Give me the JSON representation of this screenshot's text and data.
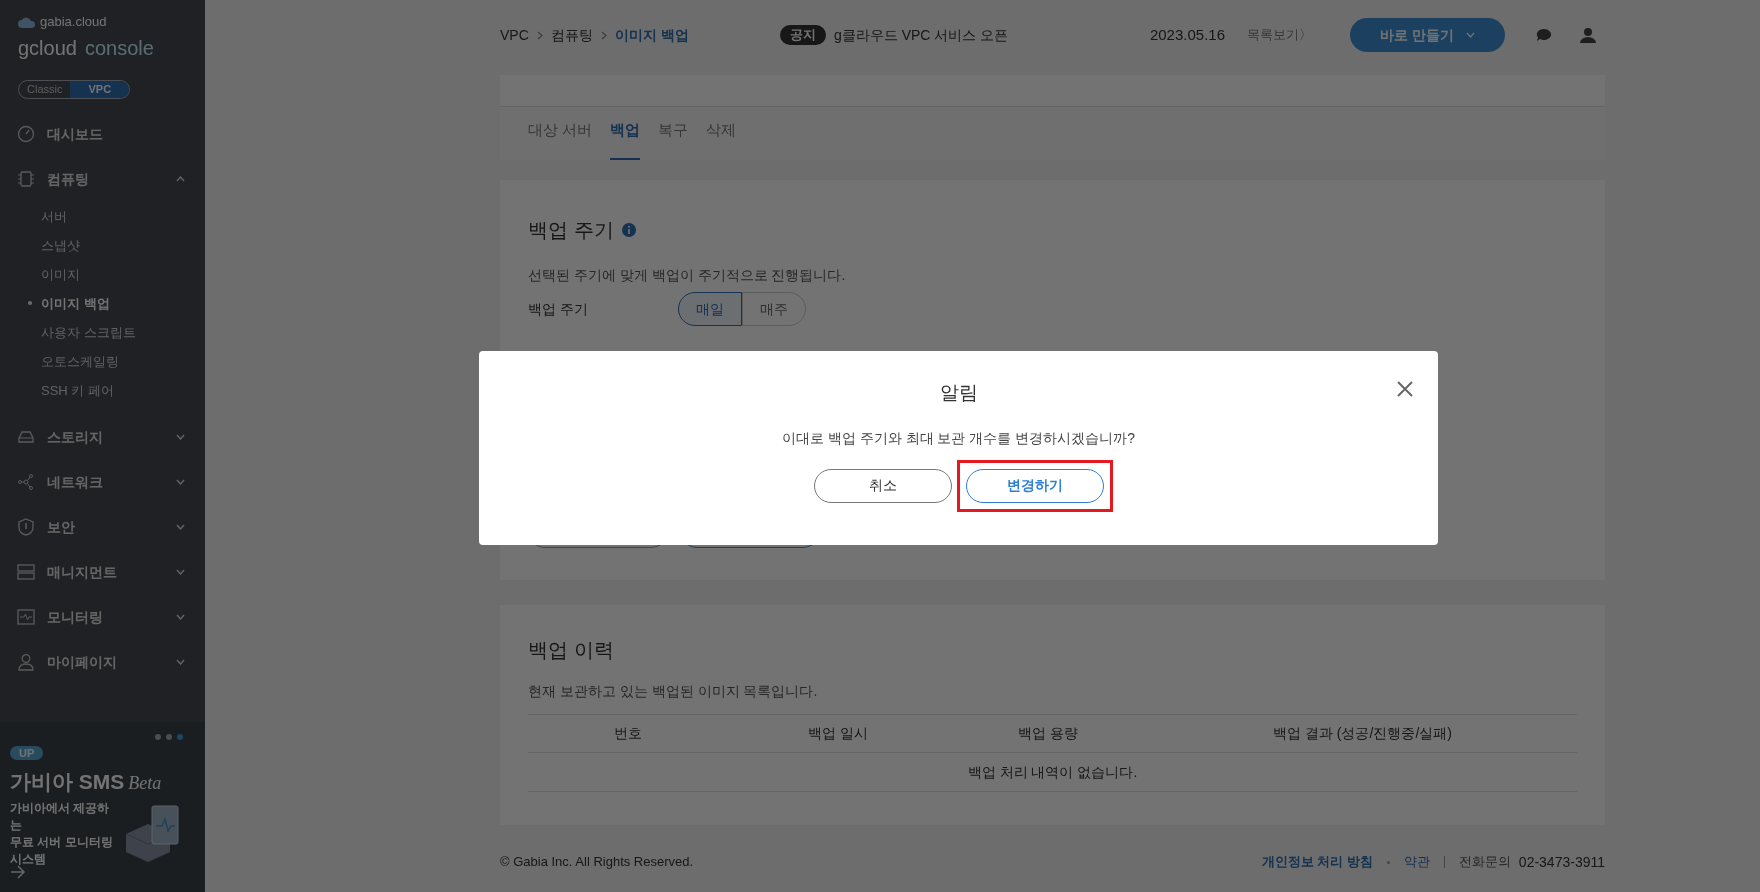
{
  "sidebar": {
    "logo": {
      "brand": "gabia.cloud",
      "product": "gcloud",
      "product_suffix": "console"
    },
    "mode_toggle": [
      {
        "label": "Classic",
        "selected": false
      },
      {
        "label": "VPC",
        "selected": true
      }
    ],
    "menu": [
      {
        "label": "대시보드"
      },
      {
        "label": "컴퓨팅",
        "expanded": true,
        "children": [
          {
            "label": "서버",
            "selected": false
          },
          {
            "label": "스냅샷",
            "selected": false
          },
          {
            "label": "이미지",
            "selected": false
          },
          {
            "label": "이미지 백업",
            "selected": true
          },
          {
            "label": "사용자 스크립트",
            "selected": false
          },
          {
            "label": "오토스케일링",
            "selected": false
          },
          {
            "label": "SSH 키 페어",
            "selected": false
          }
        ]
      },
      {
        "label": "스토리지",
        "expanded": false
      },
      {
        "label": "네트워크",
        "expanded": false
      },
      {
        "label": "보안",
        "expanded": false
      },
      {
        "label": "매니지먼트",
        "expanded": false
      },
      {
        "label": "모니터링",
        "expanded": false
      },
      {
        "label": "마이페이지",
        "expanded": false
      }
    ],
    "promo": {
      "pager": [
        {
          "selected": false
        },
        {
          "selected": false
        },
        {
          "selected": true
        }
      ],
      "badge": "UP",
      "title": "가비아 SMS",
      "title_tag": "Beta",
      "lines": [
        "가비아에서 제공하는",
        "무료 서버 모니터링",
        "시스템"
      ]
    }
  },
  "header": {
    "breadcrumb": [
      {
        "label": "VPC",
        "current": false
      },
      {
        "label": "컴퓨팅",
        "current": false
      },
      {
        "label": "이미지 백업",
        "current": true
      }
    ],
    "notice": {
      "badge": "공지",
      "text": "g클라우드 VPC 서비스 오픈",
      "date": "2023.05.16",
      "more": "목록보기〉"
    },
    "create_button": "바로 만들기"
  },
  "tabs": [
    {
      "label": "대상 서버",
      "selected": false
    },
    {
      "label": "백업",
      "selected": true
    },
    {
      "label": "복구",
      "selected": false
    },
    {
      "label": "삭제",
      "selected": false
    }
  ],
  "backup_cycle": {
    "title": "백업 주기",
    "description": "선택된 주기에 맞게 백업이 주기적으로 진행됩니다.",
    "field_label": "백업 주기",
    "options": [
      {
        "label": "매일",
        "selected": true
      },
      {
        "label": "매주",
        "selected": false
      }
    ]
  },
  "history": {
    "title": "백업 이력",
    "description": "현재 보관하고 있는 백업된 이미지 목록입니다.",
    "columns": [
      "번호",
      "백업 일시",
      "백업 용량",
      "백업 결과 (성공/진행중/실패)"
    ],
    "empty_message": "백업 처리 내역이 없습니다."
  },
  "footer": {
    "copyright": "© Gabia Inc. All Rights Reserved.",
    "links": [
      "개인정보 처리 방침",
      "약관"
    ],
    "contact_label": "전화문의",
    "phone": "02-3473-3911"
  },
  "modal": {
    "title": "알림",
    "message": "이대로 백업 주기와 최대 보관 개수를 변경하시겠습니까?",
    "buttons": [
      {
        "label": "취소",
        "kind": "secondary",
        "highlighted": false
      },
      {
        "label": "변경하기",
        "kind": "primary",
        "highlighted": true
      }
    ]
  }
}
